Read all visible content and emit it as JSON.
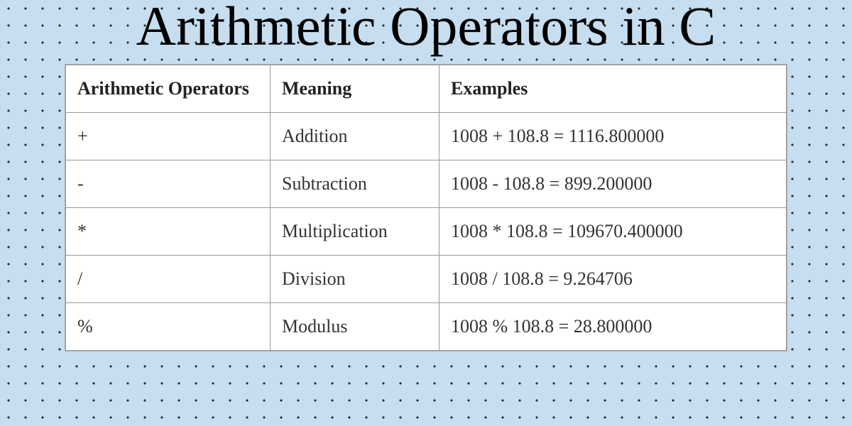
{
  "title": "Arithmetic Operators in C",
  "table": {
    "headers": {
      "operator": "Arithmetic Operators",
      "meaning": "Meaning",
      "examples": "Examples"
    },
    "rows": [
      {
        "operator": "+",
        "meaning": "Addition",
        "example": "1008 + 108.8 = 1116.800000"
      },
      {
        "operator": "-",
        "meaning": "Subtraction",
        "example": "1008 - 108.8 = 899.200000"
      },
      {
        "operator": "*",
        "meaning": "Multiplication",
        "example": "1008 * 108.8 = 109670.400000"
      },
      {
        "operator": "/",
        "meaning": "Division",
        "example": "1008 / 108.8 = 9.264706"
      },
      {
        "operator": "%",
        "meaning": "Modulus",
        "example": "1008 % 108.8 = 28.800000"
      }
    ]
  },
  "chart_data": {
    "type": "table",
    "title": "Arithmetic Operators in C",
    "columns": [
      "Arithmetic Operators",
      "Meaning",
      "Examples"
    ],
    "rows": [
      [
        "+",
        "Addition",
        "1008 + 108.8 = 1116.800000"
      ],
      [
        "-",
        "Subtraction",
        "1008 - 108.8 = 899.200000"
      ],
      [
        "*",
        "Multiplication",
        "1008 * 108.8 = 109670.400000"
      ],
      [
        "/",
        "Division",
        "1008 / 108.8 = 9.264706"
      ],
      [
        "%",
        "Modulus",
        "1008 % 108.8 = 28.800000"
      ]
    ]
  }
}
